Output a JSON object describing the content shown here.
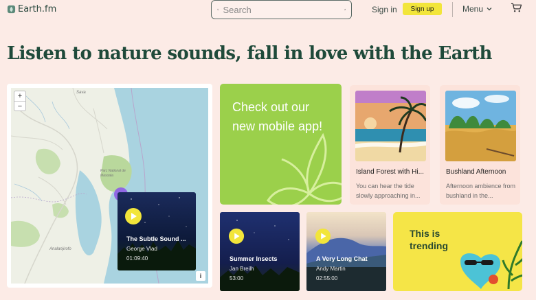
{
  "header": {
    "logo_text": "Earth.fm",
    "search_placeholder": "Search",
    "signin_label": "Sign in",
    "signup_label": "Sign up",
    "menu_label": "Menu"
  },
  "headline": "Listen to nature sounds, fall in love with the Earth",
  "map": {
    "zoom_in": "+",
    "zoom_out": "−",
    "info": "i",
    "place_labels": [
      "Sava",
      "Parc National de Masoala",
      "Analanjirofo"
    ],
    "popup": {
      "title": "The Subtle Sound ...",
      "artist": "George Vlad",
      "duration": "01:09:40"
    }
  },
  "promo": {
    "text": "Check out our new mobile app!"
  },
  "cards": [
    {
      "title": "Island Forest with Hi...",
      "description": "You can hear the tide slowly approaching in..."
    },
    {
      "title": "Bushland Afternoon",
      "description": "Afternoon ambience from bushland in the..."
    }
  ],
  "tracks": [
    {
      "title": "Summer Insects",
      "artist": "Jan Breilh",
      "duration": "53:00"
    },
    {
      "title": "A Very Long Chat",
      "artist": "Andy Martin",
      "duration": "02:55:00"
    }
  ],
  "trending": {
    "text": "This is trending"
  },
  "colors": {
    "background": "#fcebe6",
    "accent_yellow": "#f2e53a",
    "promo_green": "#9bd04b",
    "trending_yellow": "#f5e547",
    "map_pin": "#8e5ce6",
    "headline": "#1f4a3a"
  },
  "icons": [
    "logo-icon",
    "search-icon",
    "filter-icon",
    "chevron-down-icon",
    "cart-icon",
    "play-icon"
  ]
}
